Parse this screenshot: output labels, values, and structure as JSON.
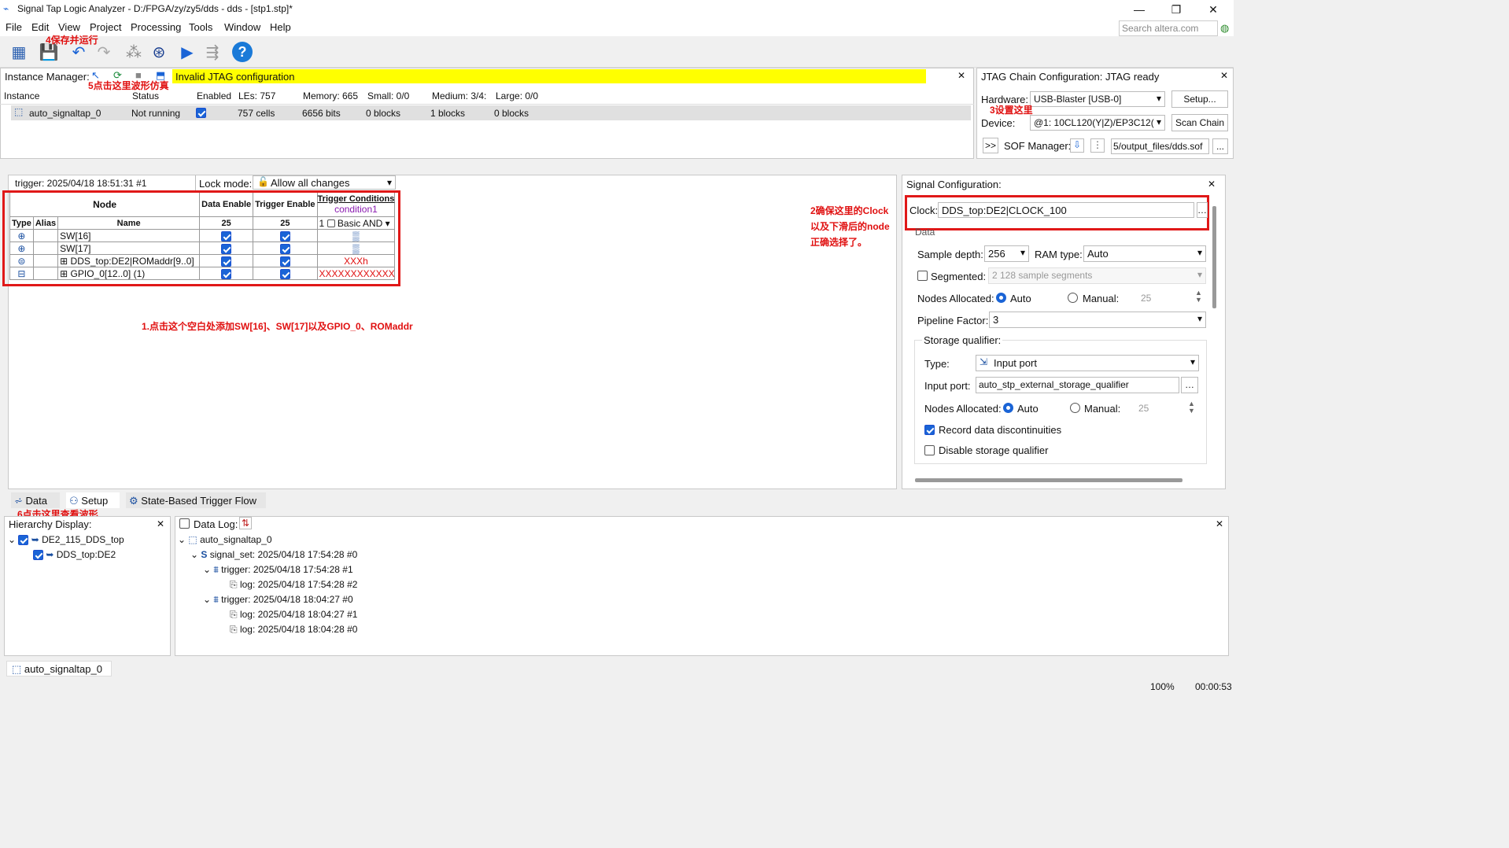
{
  "window": {
    "title": "Signal Tap Logic Analyzer - D:/FPGA/zy/zy5/dds - dds - [stp1.stp]*"
  },
  "menu": [
    "File",
    "Edit",
    "View",
    "Project",
    "Processing",
    "Tools",
    "Window",
    "Help"
  ],
  "search": {
    "placeholder": "Search altera.com"
  },
  "annotations": {
    "a1": "1.点击这个空白处添加SW[16]、SW[17]以及GPIO_0、ROMaddr",
    "a2": "2确保这里的Clock以及下滑后的node正确选择了。",
    "a3": "3设置这里",
    "a4": "4保存并运行",
    "a5": "5点击这里波形仿真",
    "a6": "6点击这里查看波形"
  },
  "instance_manager": {
    "label": "Instance Manager:",
    "message": "Invalid JTAG configuration",
    "headers": [
      "Instance",
      "Status",
      "Enabled",
      "LEs: 757",
      "Memory: 665",
      "Small: 0/0",
      "Medium: 3/4:",
      "Large: 0/0"
    ],
    "row": {
      "instance": "auto_signaltap_0",
      "status": "Not running",
      "les": "757 cells",
      "memory": "6656 bits",
      "small": "0 blocks",
      "medium": "1 blocks",
      "large": "0 blocks"
    }
  },
  "jtag": {
    "title": "JTAG Chain Configuration:  JTAG ready",
    "hardware_label": "Hardware:",
    "hardware": "USB-Blaster [USB-0]",
    "setup": "Setup...",
    "device_label": "Device:",
    "device": "@1: 10CL120(Y|Z)/EP3C12(",
    "scan": "Scan Chain",
    "sof_btn": ">>",
    "sof_label": "SOF Manager:",
    "sof_file": "5/output_files/dds.sof",
    "sof_more": "..."
  },
  "node_panel": {
    "trigger": "trigger: 2025/04/18 18:51:31  #1",
    "lock_label": "Lock mode:",
    "lock_mode": "Allow all changes",
    "h_node": "Node",
    "h_data": "Data Enable",
    "h_trig": "Trigger Enable",
    "h_cond": "Trigger Conditions",
    "h_cond1": "condition1",
    "h_type": "Type",
    "h_alias": "Alias",
    "h_name": "Name",
    "n_data": "25",
    "n_trig": "25",
    "n_cond": "1",
    "basic": "Basic AND",
    "rows": [
      {
        "name": "SW[16]",
        "cond": "▒"
      },
      {
        "name": "SW[17]",
        "cond": "▒"
      },
      {
        "name": "DDS_top:DE2|ROMaddr[9..0]",
        "cond": "XXXh"
      },
      {
        "name": "GPIO_0[12..0] (1)",
        "cond": "XXXXXXXXXXXXX"
      }
    ]
  },
  "signal_config": {
    "title": "Signal Configuration:",
    "clock_label": "Clock:",
    "clock": "DDS_top:DE2|CLOCK_100",
    "data": "Data",
    "depth_label": "Sample depth:",
    "depth": "256",
    "ram_label": "RAM type:",
    "ram": "Auto",
    "segmented": "Segmented:",
    "seg_val": "2  128 sample segments",
    "nodes_label": "Nodes Allocated:",
    "auto": "Auto",
    "manual": "Manual:",
    "manual_val": "25",
    "pipeline_label": "Pipeline Factor:",
    "pipeline": "3",
    "storage": "Storage qualifier:",
    "type_label": "Type:",
    "type": "Input port",
    "input_label": "Input port:",
    "input": "auto_stp_external_storage_qualifier",
    "nodes2_label": "Nodes Allocated:",
    "auto2": "Auto",
    "manual2": "Manual:",
    "manual2_val": "25",
    "record": "Record data discontinuities",
    "disable": "Disable storage qualifier"
  },
  "tabs": [
    "Data",
    "Setup",
    "State-Based Trigger Flow"
  ],
  "hierarchy": {
    "title": "Hierarchy Display:",
    "root": "DE2_115_DDS_top",
    "child": "DDS_top:DE2"
  },
  "datalog": {
    "title": "Data Log:",
    "items": [
      "auto_signaltap_0",
      "signal_set: 2025/04/18 17:54:28  #0",
      "trigger: 2025/04/18 17:54:28  #1",
      "log: 2025/04/18 17:54:28  #2",
      "trigger: 2025/04/18 18:04:27  #0",
      "log: 2025/04/18 18:04:27  #1",
      "log: 2025/04/18 18:04:28  #0"
    ]
  },
  "status": {
    "instance": "auto_signaltap_0",
    "zoom": "100%",
    "time": "00:00:53"
  }
}
